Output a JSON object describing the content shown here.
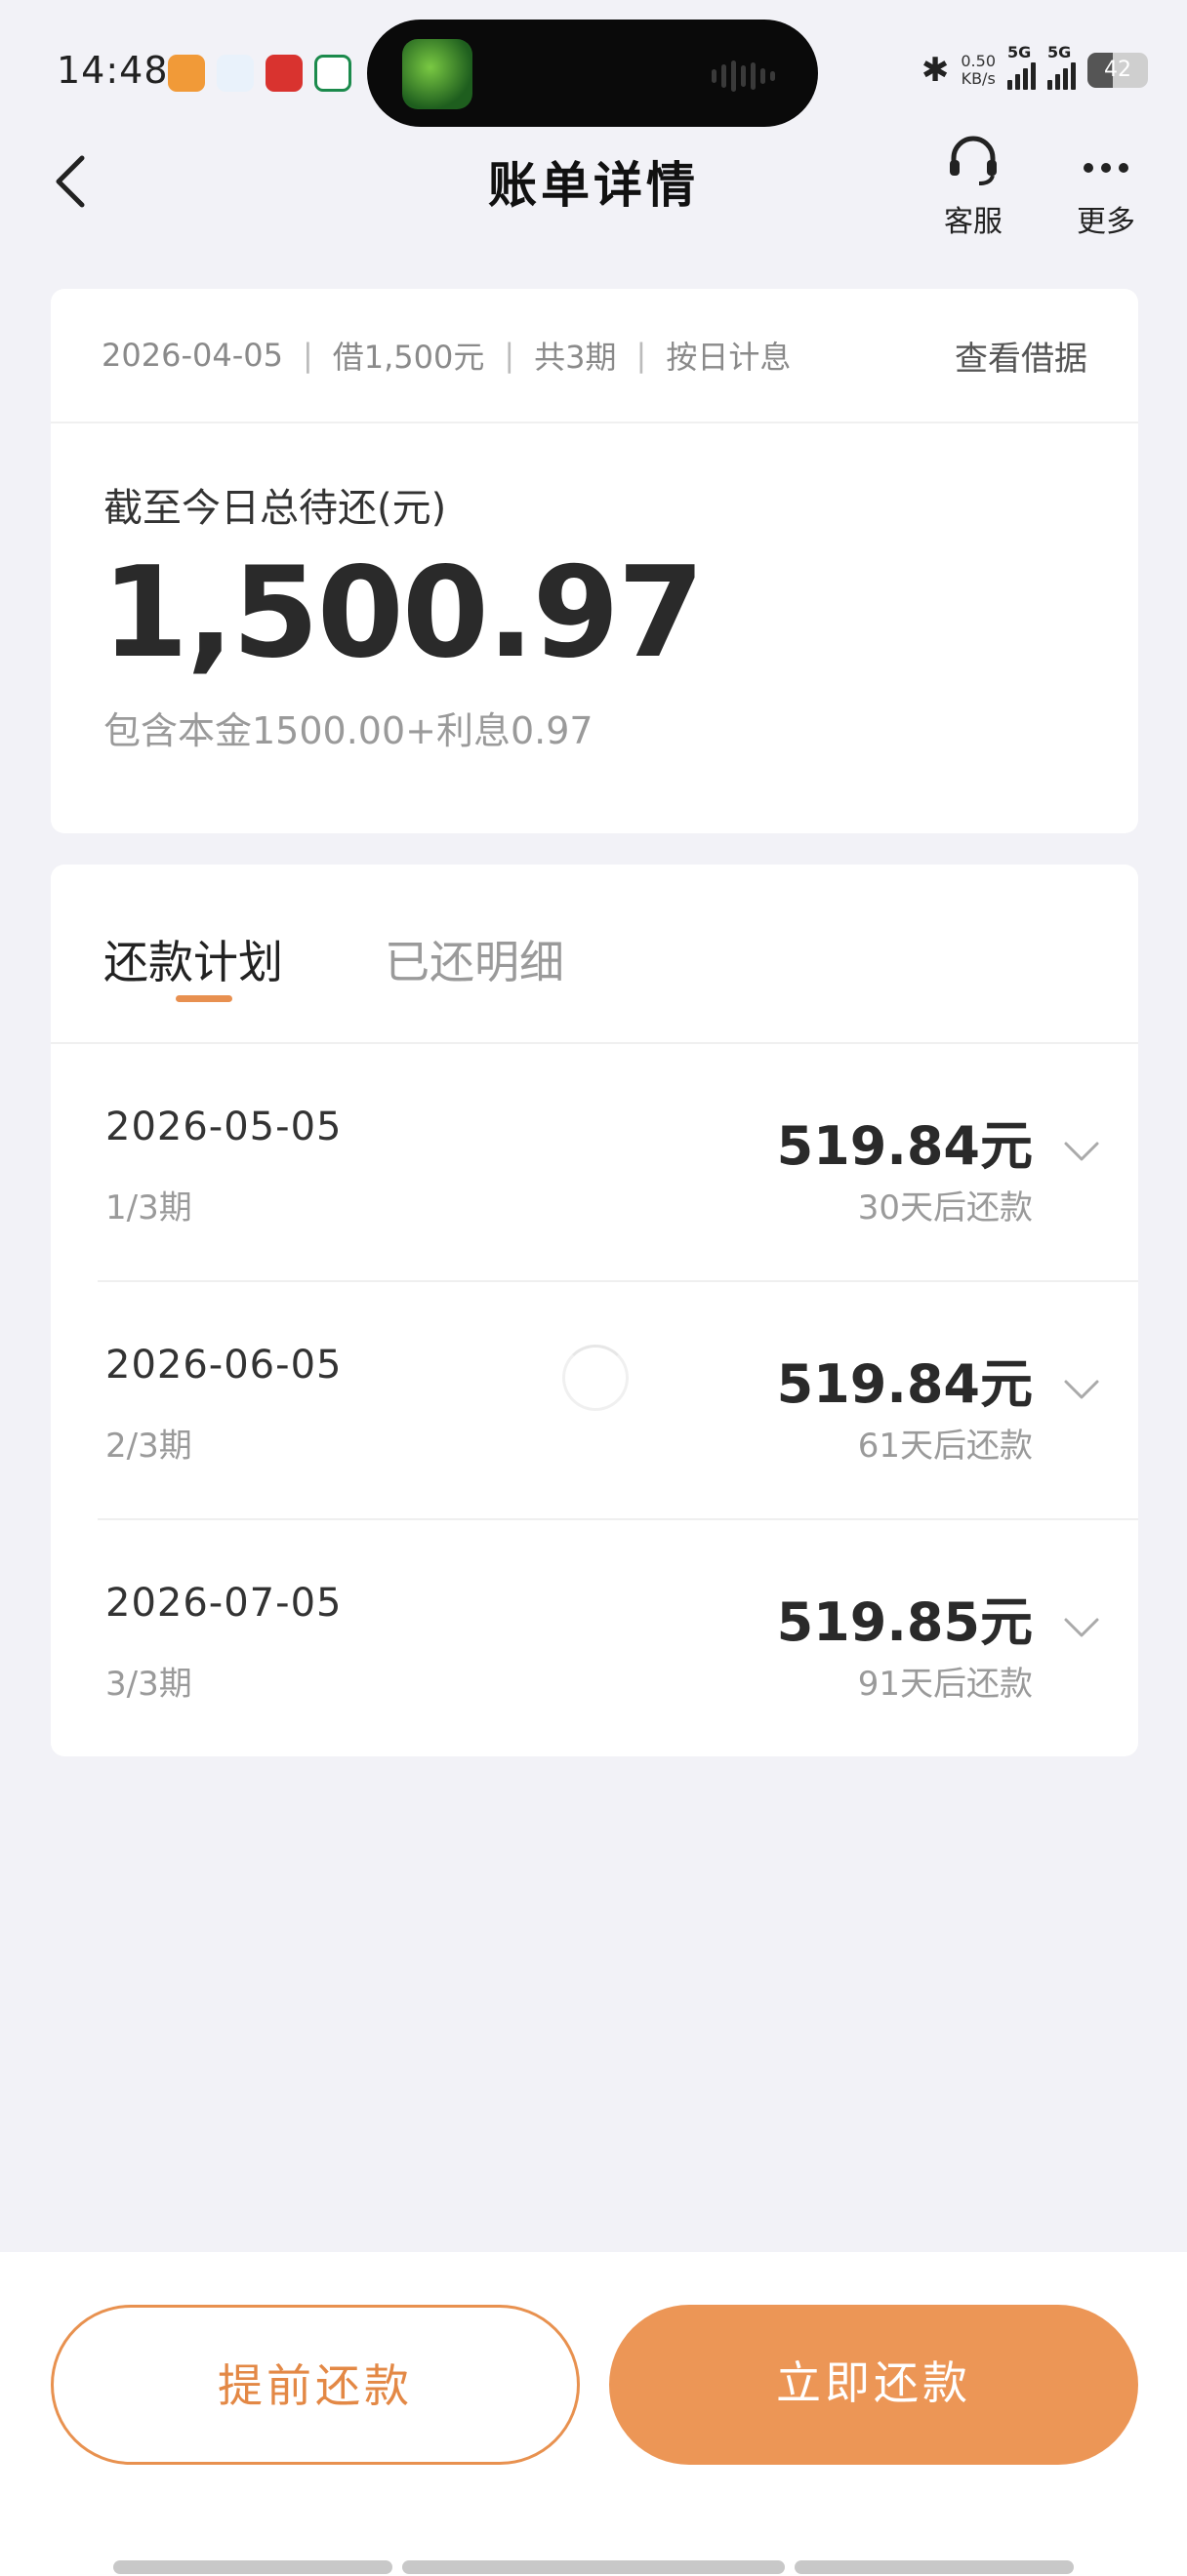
{
  "status_bar": {
    "time": "14:48",
    "net_speed_value": "0.50",
    "net_speed_unit": "KB/s",
    "signal1": "5G",
    "signal2": "5G",
    "battery": "42",
    "battery_level": 0.42
  },
  "nav": {
    "title": "账单详情",
    "service_label": "客服",
    "more_label": "更多"
  },
  "summary": {
    "loan_date": "2026-04-05",
    "loan_amount": "借1,500元",
    "periods": "共3期",
    "interest_type": "按日计息",
    "view_contract": "查看借据",
    "total_label": "截至今日总待还(元)",
    "total_amount": "1,500.97",
    "total_detail": "包含本金1500.00+利息0.97"
  },
  "tabs": [
    {
      "label": "还款计划",
      "active": true
    },
    {
      "label": "已还明细",
      "active": false
    }
  ],
  "plan": [
    {
      "date": "2026-05-05",
      "period": "1/3期",
      "amount": "519.84元",
      "due": "30天后还款"
    },
    {
      "date": "2026-06-05",
      "period": "2/3期",
      "amount": "519.84元",
      "due": "61天后还款"
    },
    {
      "date": "2026-07-05",
      "period": "3/3期",
      "amount": "519.85元",
      "due": "91天后还款"
    }
  ],
  "actions": {
    "prepay": "提前还款",
    "pay_now": "立即还款"
  },
  "colors": {
    "accent": "#EC9656",
    "accent_border": "#E8914F",
    "background": "#F2F2F7"
  }
}
